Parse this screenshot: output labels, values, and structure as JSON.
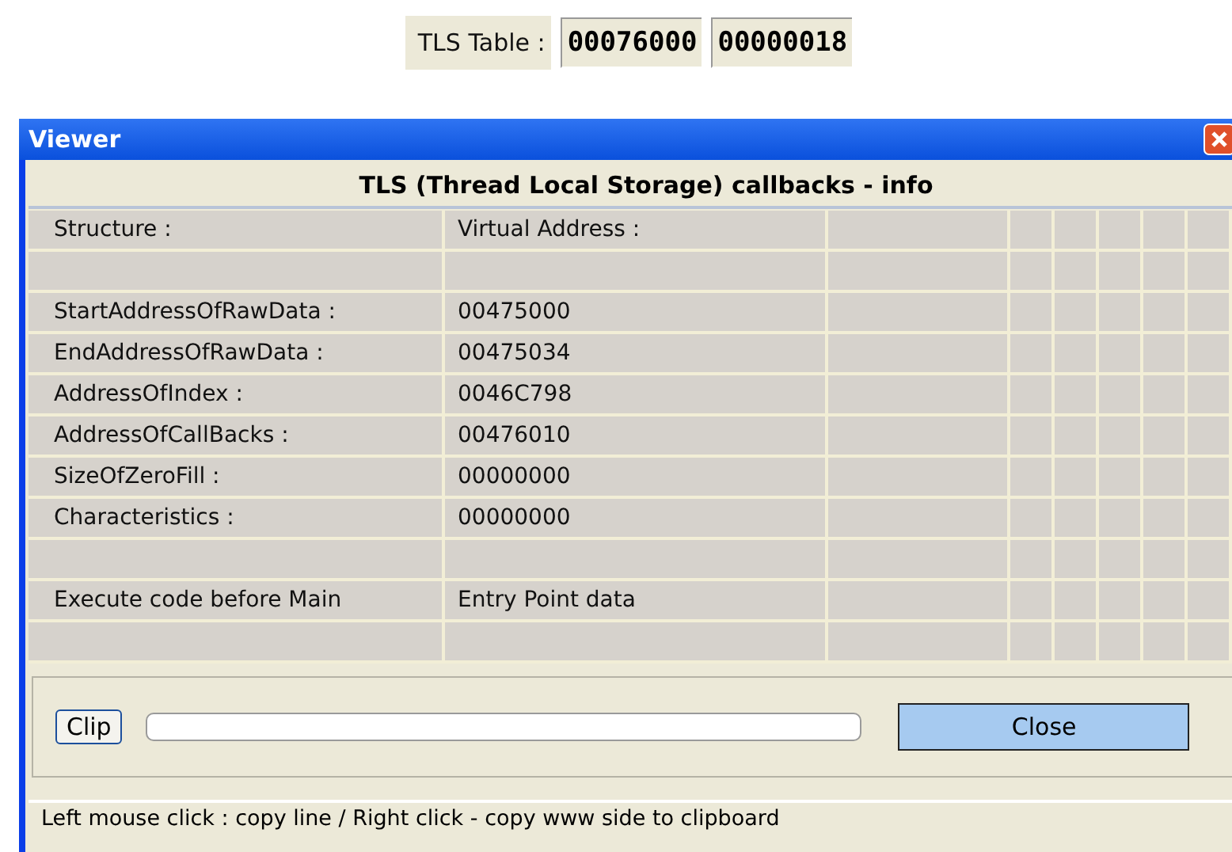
{
  "tls_table": {
    "label": "TLS Table :",
    "fields": [
      "00076000",
      "00000018"
    ]
  },
  "window": {
    "title": "Viewer"
  },
  "info_header": "TLS (Thread Local Storage) callbacks - info",
  "table": {
    "rows": [
      {
        "structure": "Structure :",
        "value": "Virtual Address :"
      },
      {
        "structure": "",
        "value": ""
      },
      {
        "structure": "StartAddressOfRawData :",
        "value": "00475000"
      },
      {
        "structure": "EndAddressOfRawData :",
        "value": "00475034"
      },
      {
        "structure": "AddressOfIndex :",
        "value": "0046C798"
      },
      {
        "structure": "AddressOfCallBacks :",
        "value": "00476010"
      },
      {
        "structure": "SizeOfZeroFill :",
        "value": "00000000"
      },
      {
        "structure": "Characteristics :",
        "value": "00000000"
      },
      {
        "structure": "",
        "value": ""
      },
      {
        "structure": "Execute code before Main",
        "value": "Entry Point data"
      },
      {
        "structure": "",
        "value": ""
      }
    ]
  },
  "buttons": {
    "clip": "Clip",
    "close": "Close"
  },
  "progress": {
    "level": 0
  },
  "status_bar": "Left mouse click : copy line / Right click - copy www side to clipboard"
}
